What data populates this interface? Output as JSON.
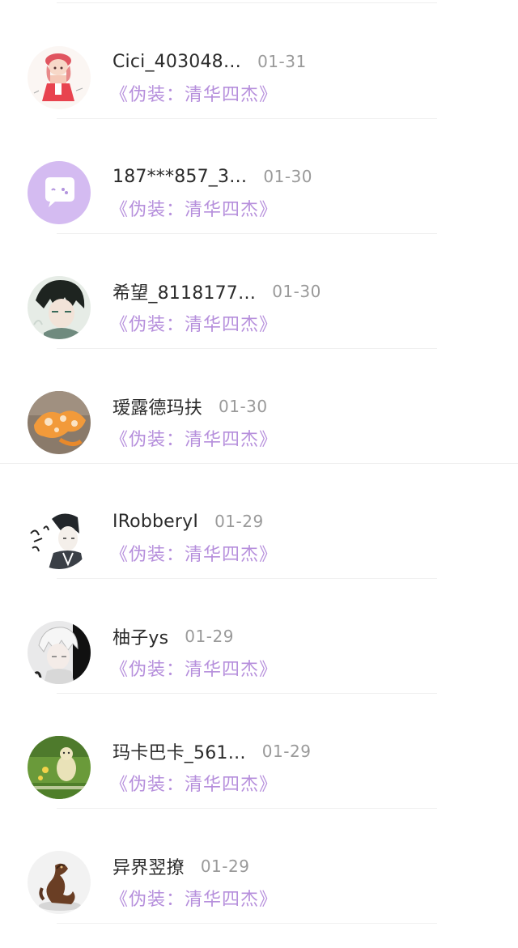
{
  "items": [
    {
      "name": "Cici_403048…",
      "date": "01-31",
      "title": "《伪装：清华四杰》",
      "avatar_icon": "girl-red-hat-avatar"
    },
    {
      "name": "187***857_3…",
      "date": "01-30",
      "title": "《伪装：清华四杰》",
      "avatar_icon": "default-chat-bubble-avatar"
    },
    {
      "name": "希望_8118177…",
      "date": "01-30",
      "title": "《伪装：清华四杰》",
      "avatar_icon": "anime-boy-avatar"
    },
    {
      "name": "瑷露德玛扶",
      "date": "01-30",
      "title": "《伪装：清华四杰》",
      "avatar_icon": "orange-flower-avatar"
    },
    {
      "name": "IRobberyI",
      "date": "01-29",
      "title": "《伪装：清华四杰》",
      "avatar_icon": "sketch-boy-avatar"
    },
    {
      "name": "柚子ys",
      "date": "01-29",
      "title": "《伪装：清华四杰》",
      "avatar_icon": "white-hair-boy-avatar"
    },
    {
      "name": "玛卡巴卡_561…",
      "date": "01-29",
      "title": "《伪装：清华四杰》",
      "avatar_icon": "green-field-creature-avatar"
    },
    {
      "name": "异界翌撩",
      "date": "01-29",
      "title": "《伪装：清华四杰》",
      "avatar_icon": "bronze-dragon-avatar"
    }
  ],
  "colors": {
    "title_link": "#b68fdc",
    "name_text": "#2b2b2b",
    "date_text": "#9a9a9a",
    "divider": "#f0f0f0",
    "default_avatar_bg": "#d4bbf1"
  }
}
